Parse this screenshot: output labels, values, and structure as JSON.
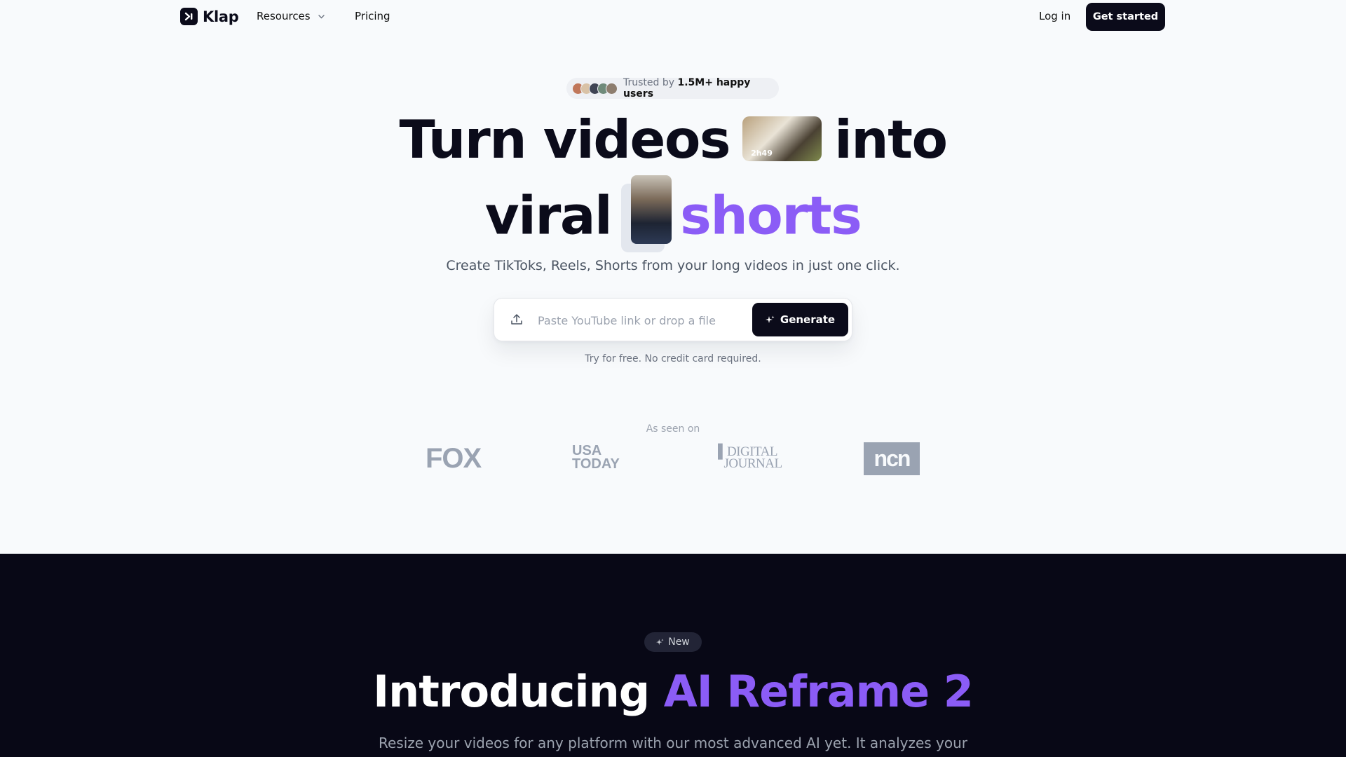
{
  "nav": {
    "brand": "Klap",
    "resources_label": "Resources",
    "pricing_label": "Pricing",
    "login_label": "Log in",
    "cta_label": "Get started"
  },
  "hero": {
    "trust_prefix": "Trusted by",
    "trust_count": "1.5M+ happy users",
    "headline_line1_a": "Turn videos",
    "headline_line1_b": "into",
    "headline_line2_a": "viral",
    "headline_line2_highlight": "shorts",
    "thumb_duration": "2h49",
    "subtitle": "Create TikToks, Reels, Shorts from your long videos in just one click.",
    "input_placeholder": "Paste YouTube link or drop a file",
    "generate_label": "Generate",
    "note": "Try for free. No credit card required."
  },
  "press": {
    "label": "As seen on",
    "logos": [
      "FOX",
      "USA TODAY",
      "DIGITAL JOURNAL",
      "ncn"
    ]
  },
  "feature": {
    "badge": "New",
    "title_a": "Introducing",
    "title_highlight": "AI Reframe 2",
    "subtitle": "Resize your videos for any platform with our most advanced AI yet. It analyzes your"
  },
  "colors": {
    "accent": "#8b5cf6",
    "dark": "#0b0b1a",
    "background": "#f8fafc"
  }
}
